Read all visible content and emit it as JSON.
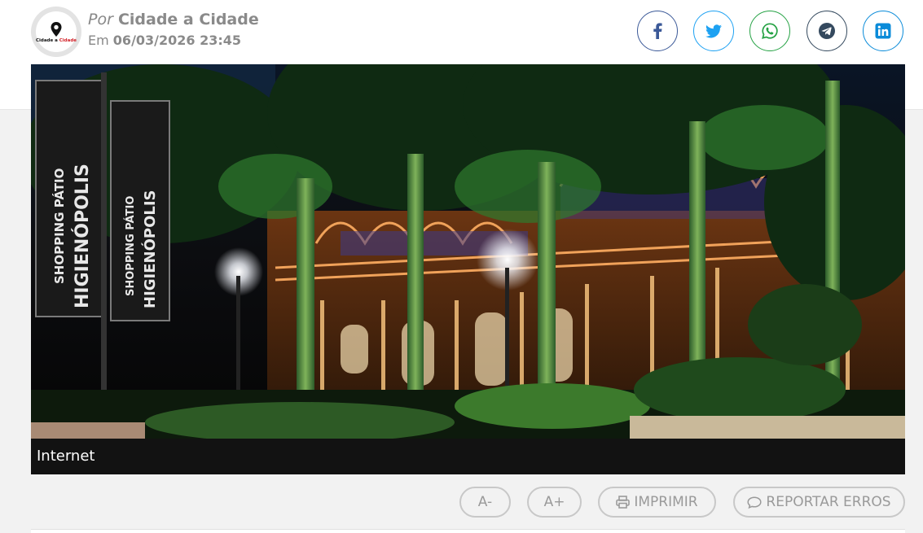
{
  "author": {
    "prefix": "Por",
    "name": "Cidade a Cidade",
    "date_prefix": "Em",
    "date": "06/03/2026 23:45",
    "avatar_logo": {
      "text_dark": "Cidade a ",
      "text_accent": "Cidade",
      "icon": "map-pin-icon"
    }
  },
  "share": [
    {
      "name": "facebook",
      "icon": "facebook-icon",
      "color": "#3b5998"
    },
    {
      "name": "twitter",
      "icon": "twitter-icon",
      "color": "#1da1f2"
    },
    {
      "name": "whatsapp",
      "icon": "whatsapp-icon",
      "color": "#25a244"
    },
    {
      "name": "telegram",
      "icon": "telegram-icon",
      "color": "#34495e"
    },
    {
      "name": "linkedin",
      "icon": "linkedin-icon",
      "color": "#0a8bd9"
    }
  ],
  "photo": {
    "banner_text_1": "SHOPPING PÁTIO",
    "banner_text_2": "HIGIENÓPOLIS",
    "caption": "Internet"
  },
  "toolbar": {
    "font_decrease": "A-",
    "font_increase": "A+",
    "print_label": "IMPRIMIR",
    "report_label": "REPORTAR ERROS",
    "print_icon": "printer-icon",
    "report_icon": "comment-icon"
  },
  "colors": {
    "background": "#f2f2f2",
    "caption_bg": "#121212",
    "muted_text": "#888888"
  }
}
